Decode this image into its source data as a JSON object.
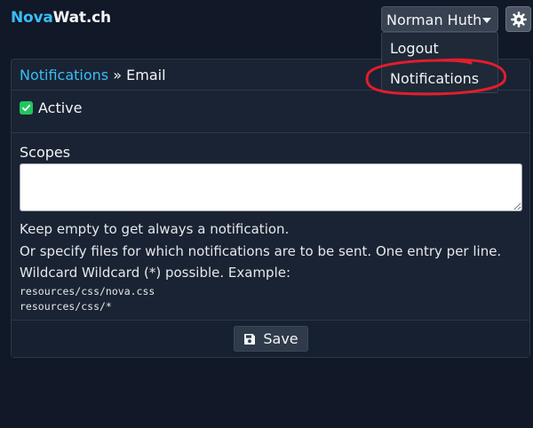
{
  "navbar": {
    "brand_part1": "Nova",
    "brand_part2": "Wat.ch",
    "user_name": "Norman Huth",
    "settings_icon": "gear-icon",
    "caret_icon": "caret-down-icon"
  },
  "dropdown": {
    "items": [
      {
        "label": "Logout"
      },
      {
        "label": "Notifications"
      }
    ]
  },
  "card": {
    "breadcrumb_link": "Notifications",
    "breadcrumb_separator": "»",
    "breadcrumb_current": "Email",
    "active_label": "Active",
    "active_checked": true,
    "scopes_label": "Scopes",
    "scopes_value": "",
    "help_lines": [
      "Keep empty to get always a notification.",
      "Or specify files for which notifications are to be sent. One entry per line.",
      "Wildcard Wildcard (*) possible. Example:"
    ],
    "code_examples": [
      "resources/css/nova.css",
      "resources/css/*"
    ],
    "save_label": "Save",
    "save_icon": "floppy-disk-icon"
  },
  "colors": {
    "background": "#111827",
    "card": "#1a2333",
    "brand_accent": "#38bdf8",
    "checkbox": "#22c55e",
    "annotation": "#e11d2e"
  }
}
